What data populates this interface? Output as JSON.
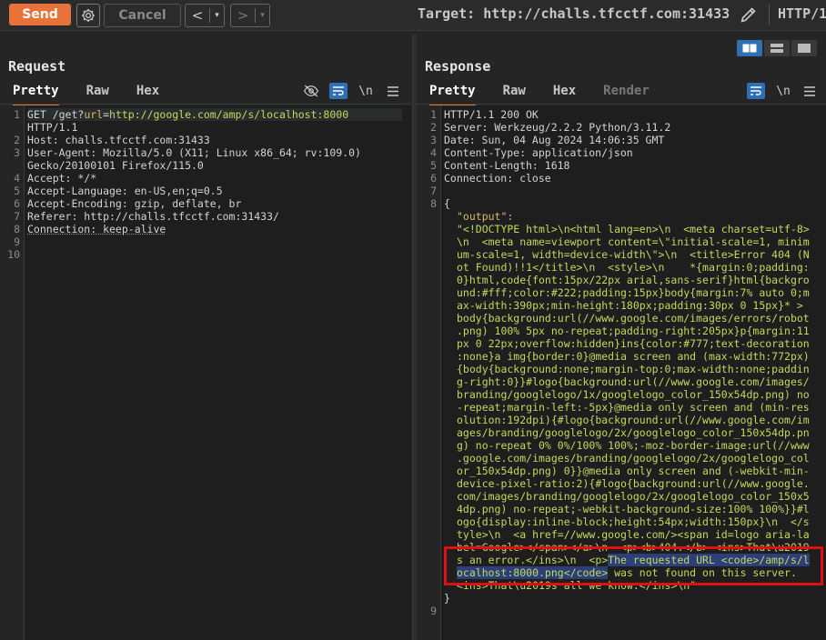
{
  "toolbar": {
    "send_label": "Send",
    "cancel_label": "Cancel",
    "back_label": "<",
    "forward_label": ">",
    "dropdown_glyph": "▾",
    "target_label": "Target: http://challs.tfcctf.com:31433",
    "protocol_label": "HTTP/1",
    "send_color": "#e8733a"
  },
  "request": {
    "title": "Request",
    "tabs": [
      "Pretty",
      "Raw",
      "Hex"
    ],
    "active_tab": "Pretty",
    "line_numbers": [
      "1",
      "2",
      "3",
      "4",
      "5",
      "6",
      "7",
      "8",
      "9",
      "10"
    ],
    "lines": [
      {
        "method": "GET /get?",
        "param": "url",
        "eq": "=",
        "value": "http://google.com/amp/s/localhost:8000"
      },
      {
        "text": "HTTP/1.1"
      },
      {
        "text": "Host: challs.tfcctf.com:31433"
      },
      {
        "text": "User-Agent: Mozilla/5.0 (X11; Linux x86_64; rv:109.0)"
      },
      {
        "text": "Gecko/20100101 Firefox/115.0"
      },
      {
        "text": "Accept: */*"
      },
      {
        "text": "Accept-Language: en-US,en;q=0.5"
      },
      {
        "text": "Accept-Encoding: gzip, deflate, br"
      },
      {
        "text": "Referer: http://challs.tfcctf.com:31433/"
      },
      {
        "text": "Connection: keep-alive"
      }
    ]
  },
  "response": {
    "title": "Response",
    "tabs": [
      "Pretty",
      "Raw",
      "Hex",
      "Render"
    ],
    "active_tab": "Pretty",
    "line_numbers": [
      "1",
      "2",
      "3",
      "4",
      "5",
      "6",
      "7",
      "8",
      "9"
    ],
    "headers": [
      "HTTP/1.1 200 OK",
      "Server: Werkzeug/2.2.2 Python/3.11.2",
      "Date: Sun, 04 Aug 2024 14:06:35 GMT",
      "Content-Type: application/json",
      "Content-Length: 1618",
      "Connection: close"
    ],
    "open_brace": "{",
    "close_brace": "}",
    "json_key": "\"output\":",
    "body_lines": [
      "\"<!DOCTYPE html>\\n<html lang=en>\\n  <meta charset=utf-8>",
      "\\n  <meta name=viewport content=\\\"initial-scale=1, minim",
      "um-scale=1, width=device-width\\\">\\n  <title>Error 404 (N",
      "ot Found)!!1</title>\\n  <style>\\n    *{margin:0;padding:",
      "0}html,code{font:15px/22px arial,sans-serif}html{backgro",
      "und:#fff;color:#222;padding:15px}body{margin:7% auto 0;m",
      "ax-width:390px;min-height:180px;padding:30px 0 15px}* >",
      "body{background:url(//www.google.com/images/errors/robot",
      ".png) 100% 5px no-repeat;padding-right:205px}p{margin:11",
      "px 0 22px;overflow:hidden}ins{color:#777;text-decoration",
      ":none}a img{border:0}@media screen and (max-width:772px)",
      "{body{background:none;margin-top:0;max-width:none;paddin",
      "g-right:0}}#logo{background:url(//www.google.com/images/",
      "branding/googlelogo/1x/googlelogo_color_150x54dp.png) no",
      "-repeat;margin-left:-5px}@media only screen and (min-res",
      "olution:192dpi){#logo{background:url(//www.google.com/im",
      "ages/branding/googlelogo/2x/googlelogo_color_150x54dp.pn",
      "g) no-repeat 0% 0%/100% 100%;-moz-border-image:url(//www",
      ".google.com/images/branding/googlelogo/2x/googlelogo_col",
      "or_150x54dp.png) 0}}@media only screen and (-webkit-min-",
      "device-pixel-ratio:2){#logo{background:url(//www.google.",
      "com/images/branding/googlelogo/2x/googlelogo_color_150x5",
      "4dp.png) no-repeat;-webkit-background-size:100% 100%}}#l",
      "ogo{display:inline-block;height:54px;width:150px}\\n  </s",
      "tyle>\\n  <a href=//www.google.com/><span id=logo aria-la",
      "bel=Google></span></a>\\n  <p><b>404.</b> <ins>That\\u2019",
      "s an error.</ins>\\n  <p>"
    ],
    "selected_1": "The requested URL <code>/amp/s/l",
    "selected_2": "ocalhost:8000.png</code>",
    "after_selected": " was not found on this server.",
    "last_line": "<ins>That\\u2019s all we know.</ins>\\n\""
  }
}
